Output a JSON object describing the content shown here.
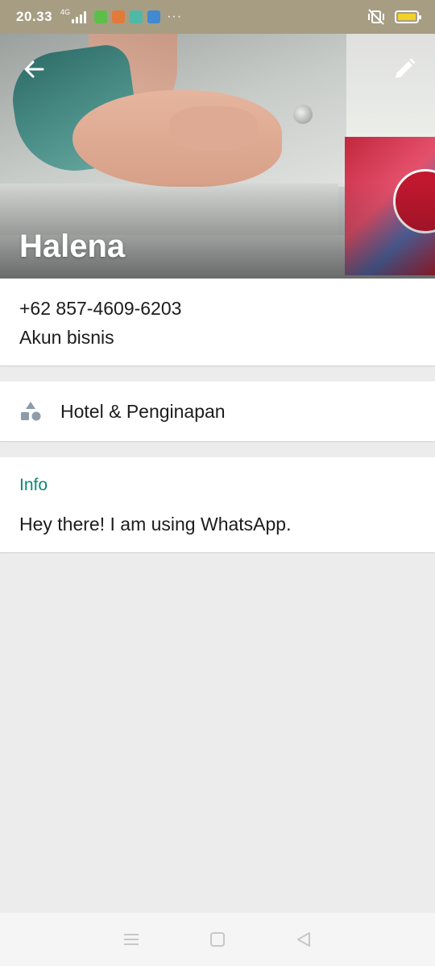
{
  "status_bar": {
    "time": "20.33",
    "network": "4G",
    "overflow": "···",
    "icons": [
      "signal-icon",
      "app-notification-icon",
      "vibrate-off-icon",
      "battery-icon"
    ],
    "battery_color": "#f2d12a"
  },
  "header": {
    "name": "Halena",
    "back_icon": "back-arrow-icon",
    "edit_icon": "pencil-icon"
  },
  "phone_card": {
    "number": "+62 857-4609-6203",
    "account_type": "Akun bisnis"
  },
  "category_card": {
    "icon": "category-shapes-icon",
    "label": "Hotel & Penginapan"
  },
  "info_card": {
    "title": "Info",
    "text": "Hey there! I am using WhatsApp."
  },
  "nav_bar": {
    "items": [
      "menu-icon",
      "home-icon",
      "back-icon"
    ]
  },
  "colors": {
    "status_bar": "#a79d83",
    "accent_teal": "#0a8a76",
    "background": "#ececec",
    "card": "#ffffff"
  }
}
